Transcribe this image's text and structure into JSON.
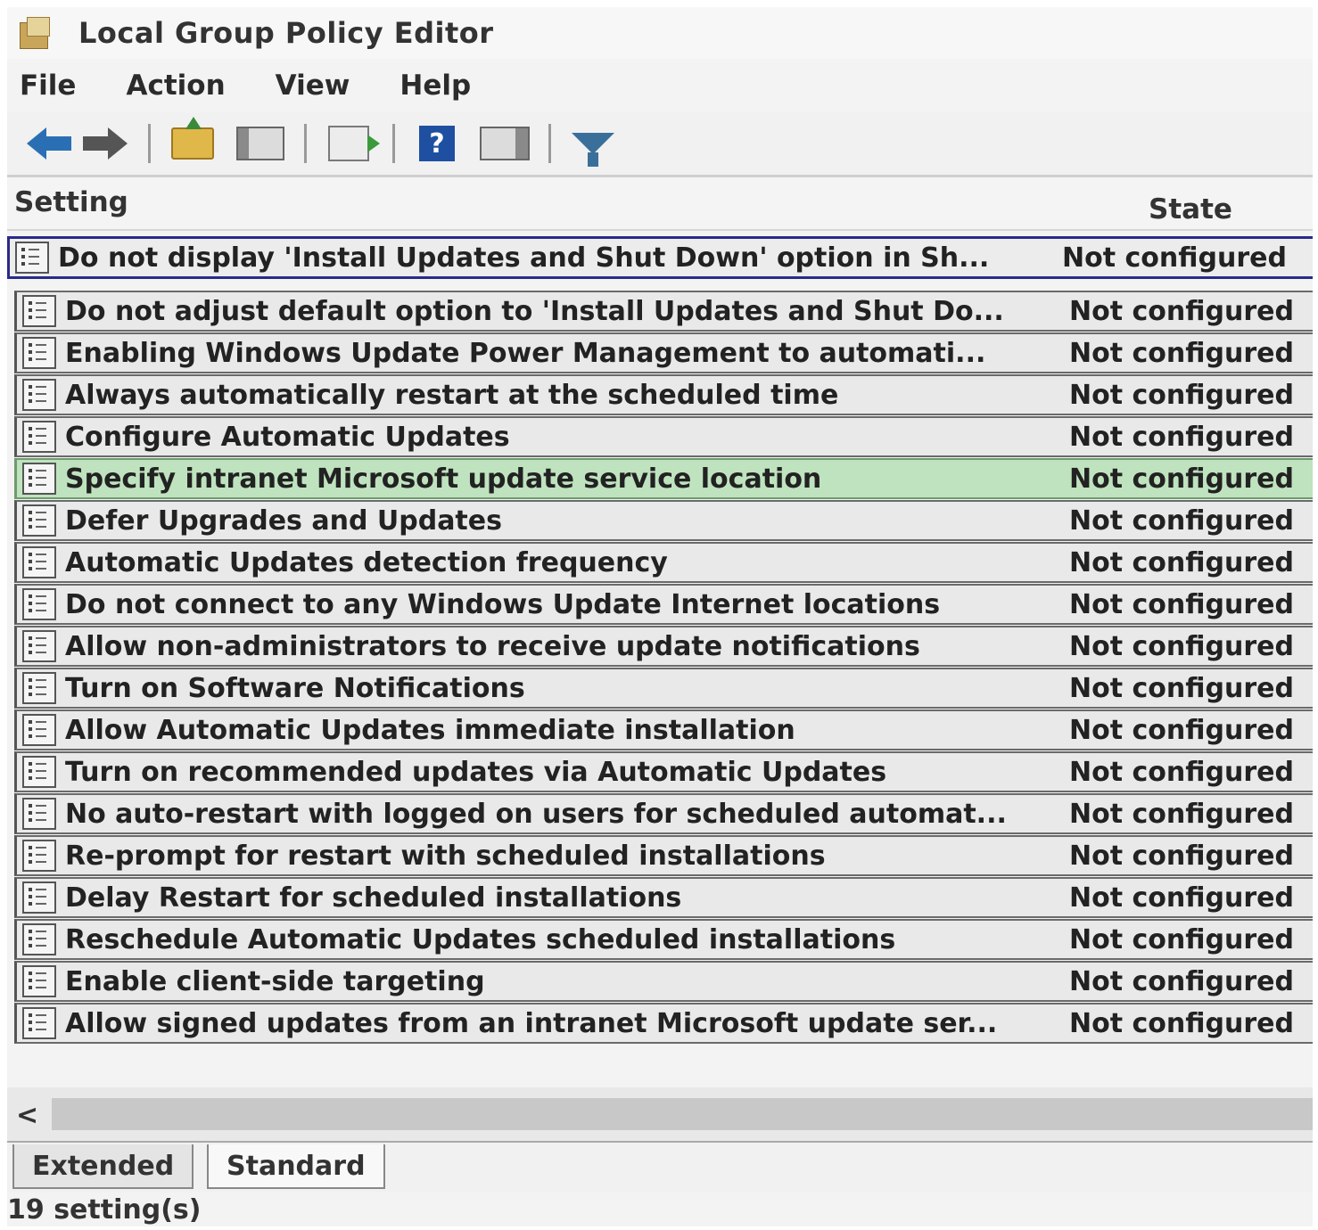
{
  "window": {
    "title": "Local Group Policy Editor"
  },
  "menubar": {
    "items": [
      "File",
      "Action",
      "View",
      "Help"
    ]
  },
  "toolbar": {
    "buttons": [
      "back-arrow-icon",
      "forward-arrow-icon",
      "up-folder-icon",
      "show-hide-console-tree-icon",
      "export-list-icon",
      "help-icon",
      "show-hide-action-pane-icon",
      "filter-icon"
    ]
  },
  "list": {
    "columns": {
      "setting": "Setting",
      "state": "State"
    },
    "rows": [
      {
        "setting": "Do not display 'Install Updates and Shut Down' option in Sh...",
        "state": "Not configured",
        "highlight": "selected"
      },
      {
        "setting": "Do not adjust default option to 'Install Updates and Shut Do...",
        "state": "Not configured"
      },
      {
        "setting": "Enabling Windows Update Power Management to automati...",
        "state": "Not configured"
      },
      {
        "setting": "Always automatically restart at the scheduled time",
        "state": "Not configured"
      },
      {
        "setting": "Configure Automatic Updates",
        "state": "Not configured"
      },
      {
        "setting": "Specify intranet Microsoft update service location",
        "state": "Not configured",
        "highlight": "green"
      },
      {
        "setting": "Defer Upgrades and Updates",
        "state": "Not configured"
      },
      {
        "setting": "Automatic Updates detection frequency",
        "state": "Not configured"
      },
      {
        "setting": "Do not connect to any Windows Update Internet locations",
        "state": "Not configured"
      },
      {
        "setting": "Allow non-administrators to receive update notifications",
        "state": "Not configured"
      },
      {
        "setting": "Turn on Software Notifications",
        "state": "Not configured"
      },
      {
        "setting": "Allow Automatic Updates immediate installation",
        "state": "Not configured"
      },
      {
        "setting": "Turn on recommended updates via Automatic Updates",
        "state": "Not configured"
      },
      {
        "setting": "No auto-restart with logged on users for scheduled automat...",
        "state": "Not configured"
      },
      {
        "setting": "Re-prompt for restart with scheduled installations",
        "state": "Not configured"
      },
      {
        "setting": "Delay Restart for scheduled installations",
        "state": "Not configured"
      },
      {
        "setting": "Reschedule Automatic Updates scheduled installations",
        "state": "Not configured"
      },
      {
        "setting": "Enable client-side targeting",
        "state": "Not configured"
      },
      {
        "setting": "Allow signed updates from an intranet Microsoft update ser...",
        "state": "Not configured"
      }
    ]
  },
  "scrollbar": {
    "left_glyph": "<"
  },
  "tabs": {
    "extended": "Extended",
    "standard": "Standard",
    "active": "Standard"
  },
  "status": {
    "text": "19 setting(s)"
  },
  "colors": {
    "selection_border": "#2a2a8a",
    "green_highlight": "#bfe3bf",
    "help_icon": "#1f4fa0"
  }
}
